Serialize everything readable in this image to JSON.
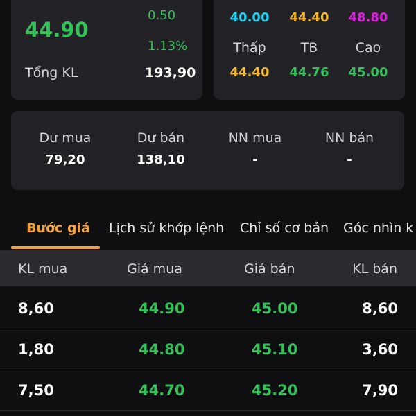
{
  "price": {
    "current": "44.90",
    "change": "0.50",
    "change_percent": "1.13%",
    "volume_label": "Tổng KL",
    "volume_value": "193,90"
  },
  "range": {
    "ref_values": {
      "floor": "40.00",
      "reference": "44.40",
      "ceiling": "48.80"
    },
    "labels": {
      "low": "Thấp",
      "avg": "TB",
      "high": "Cao"
    },
    "values": {
      "low": "44.40",
      "avg": "44.76",
      "high": "45.00"
    }
  },
  "flow": [
    {
      "label": "Dư mua",
      "value": "79,20"
    },
    {
      "label": "Dư bán",
      "value": "138,10"
    },
    {
      "label": "NN mua",
      "value": "-"
    },
    {
      "label": "NN bán",
      "value": "-"
    }
  ],
  "tabs": [
    {
      "label": "Bước giá",
      "active": true
    },
    {
      "label": "Lịch sử khớp lệnh",
      "active": false
    },
    {
      "label": "Chỉ số cơ bản",
      "active": false
    },
    {
      "label": "Góc nhìn k",
      "active": false
    }
  ],
  "table": {
    "headers": {
      "buy_volume": "KL mua",
      "buy_price": "Giá mua",
      "sell_price": "Giá bán",
      "sell_volume": "KL bán"
    },
    "rows": [
      {
        "buy_volume": "8,60",
        "buy_price": "44.90",
        "sell_price": "45.00",
        "sell_volume": "8,60"
      },
      {
        "buy_volume": "1,80",
        "buy_price": "44.80",
        "sell_price": "45.10",
        "sell_volume": "3,60"
      },
      {
        "buy_volume": "7,50",
        "buy_price": "44.70",
        "sell_price": "45.20",
        "sell_volume": "7,90"
      }
    ]
  },
  "colors": {
    "up": "#33c15a",
    "floor": "#1ed2f0",
    "reference": "#f0b42d",
    "ceiling": "#e01de3",
    "active_tab": "#f2a23a",
    "card_bg": "#222226",
    "page_bg": "#0f0f12"
  }
}
